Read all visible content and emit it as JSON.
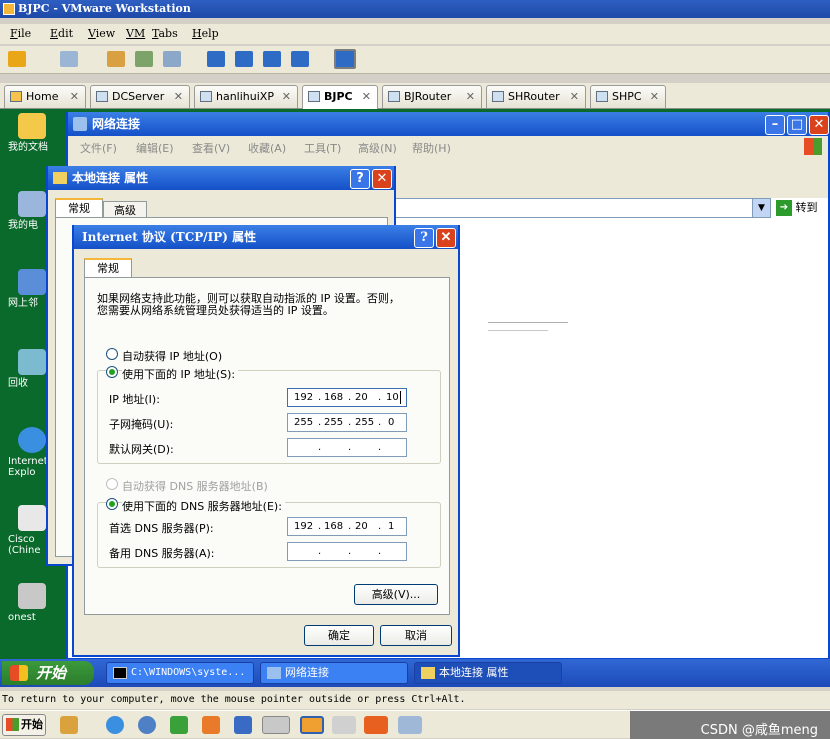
{
  "vmware": {
    "title": "BJPC - VMware Workstation",
    "menu": [
      {
        "key": "F",
        "rest": "ile"
      },
      {
        "key": "E",
        "rest": "dit"
      },
      {
        "key": "V",
        "rest": "iew"
      },
      {
        "key": "VM",
        "rest": ""
      },
      {
        "key": "T",
        "rest": "abs"
      },
      {
        "key": "H",
        "rest": "elp"
      }
    ],
    "tabs": [
      "Home",
      "DCServer",
      "hanlihuiXP",
      "BJPC",
      "BJRouter",
      "SHRouter",
      "SHPC"
    ],
    "close_glyph": "✕",
    "status": "To return to your computer, move the mouse pointer outside or press Ctrl+Alt."
  },
  "desktop": {
    "icons": [
      "我的文档",
      "我的电",
      "网上邻",
      "回收",
      "Internet Explo",
      "Cisco (Chine",
      "onest"
    ]
  },
  "network_window": {
    "title": "网络连接",
    "menu": [
      "文件(F)",
      "编辑(E)",
      "查看(V)",
      "收藏(A)",
      "工具(T)",
      "高级(N)",
      "帮助(H)"
    ],
    "go_label": "转到"
  },
  "local_props": {
    "title": "本地连接 属性",
    "tabs": [
      "常规",
      "高级"
    ]
  },
  "tcpip": {
    "title": "Internet 协议 (TCP/IP) 属性",
    "tab": "常规",
    "description_1": "如果网络支持此功能，则可以获取自动指派的 IP 设置。否则，",
    "description_2": "您需要从网络系统管理员处获得适当的 IP 设置。",
    "auto_ip": "自动获得 IP 地址(O)",
    "manual_ip": "使用下面的 IP 地址(S):",
    "ip_label": "IP 地址(I):",
    "mask_label": "子网掩码(U):",
    "gateway_label": "默认网关(D):",
    "ip": [
      "192",
      "168",
      "20",
      "10"
    ],
    "mask": [
      "255",
      "255",
      "255",
      "0"
    ],
    "gateway": [
      "",
      "",
      "",
      ""
    ],
    "auto_dns": "自动获得 DNS 服务器地址(B)",
    "manual_dns": "使用下面的 DNS 服务器地址(E):",
    "dns1_label": "首选 DNS 服务器(P):",
    "dns2_label": "备用 DNS 服务器(A):",
    "dns1": [
      "192",
      "168",
      "20",
      "1"
    ],
    "dns2": [
      "",
      "",
      "",
      ""
    ],
    "advanced_button": "高级(V)...",
    "ok_button": "确定",
    "cancel_button": "取消"
  },
  "taskbar": {
    "start": "开始",
    "tasks": [
      "C:\\WINDOWS\\syste...",
      "网络连接",
      "本地连接 属性"
    ]
  },
  "host": {
    "start": "开始",
    "watermark": "CSDN @咸鱼meng"
  }
}
